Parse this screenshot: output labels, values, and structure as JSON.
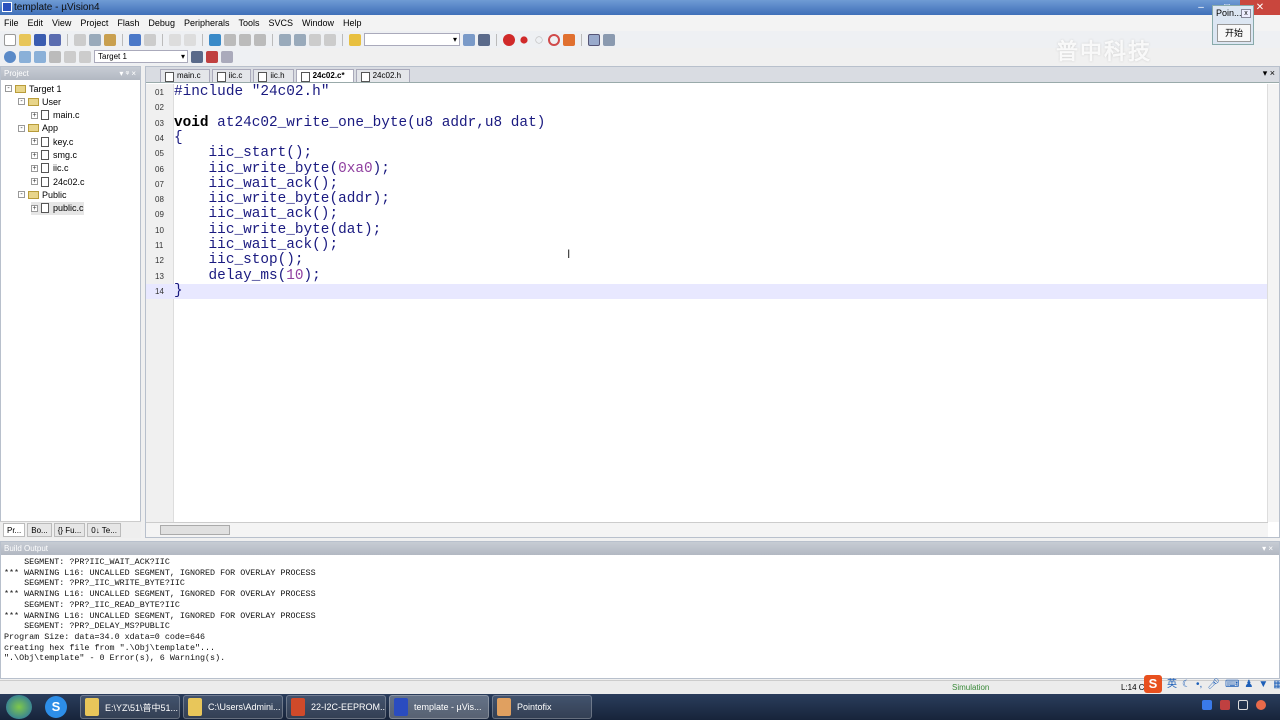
{
  "window": {
    "title": "template - µVision4"
  },
  "menu": [
    "File",
    "Edit",
    "View",
    "Project",
    "Flash",
    "Debug",
    "Peripherals",
    "Tools",
    "SVCS",
    "Window",
    "Help"
  ],
  "toolbar": {
    "target_select": "Target 1"
  },
  "watermark": "普中科技",
  "pointofix_popup": {
    "title": "Poin...",
    "close": "x",
    "start_button": "开始"
  },
  "project_panel": {
    "title": "Project",
    "header_buttons": "▾ ᵠ ×",
    "tree": [
      {
        "label": "Target 1",
        "level": 0,
        "type": "target",
        "toggle": "-"
      },
      {
        "label": "User",
        "level": 1,
        "type": "folder",
        "toggle": "-"
      },
      {
        "label": "main.c",
        "level": 2,
        "type": "file",
        "toggle": "+"
      },
      {
        "label": "App",
        "level": 1,
        "type": "folder",
        "toggle": "-"
      },
      {
        "label": "key.c",
        "level": 2,
        "type": "file",
        "toggle": "+"
      },
      {
        "label": "smg.c",
        "level": 2,
        "type": "file",
        "toggle": "+"
      },
      {
        "label": "iic.c",
        "level": 2,
        "type": "file",
        "toggle": "+"
      },
      {
        "label": "24c02.c",
        "level": 2,
        "type": "file",
        "toggle": "+"
      },
      {
        "label": "Public",
        "level": 1,
        "type": "folder",
        "toggle": "-"
      },
      {
        "label": "public.c",
        "level": 2,
        "type": "file",
        "toggle": "+",
        "selected": true
      }
    ],
    "tabs": [
      "Pr...",
      "Bo...",
      "{} Fu...",
      "0↓ Te..."
    ]
  },
  "editor": {
    "tabs": [
      {
        "label": "main.c"
      },
      {
        "label": "iic.c"
      },
      {
        "label": "iic.h"
      },
      {
        "label": "24c02.c*",
        "active": true
      },
      {
        "label": "24c02.h"
      }
    ],
    "tab_buttons": "▾ ×",
    "current_line": 14,
    "lines": [
      [
        [
          "#include ",
          "pp"
        ],
        [
          "\"24c02.h\"",
          "str"
        ]
      ],
      [],
      [
        [
          "void",
          "kw"
        ],
        [
          " at24c02_write_one_byte(u8 addr,u8 dat)",
          "pl"
        ]
      ],
      [
        [
          "{",
          "pl"
        ]
      ],
      [
        [
          "    iic_start();",
          "pl"
        ]
      ],
      [
        [
          "    iic_write_byte(",
          "pl"
        ],
        [
          "0xa0",
          "num"
        ],
        [
          ");",
          "pl"
        ]
      ],
      [
        [
          "    iic_wait_ack();",
          "pl"
        ]
      ],
      [
        [
          "    iic_write_byte(addr);",
          "pl"
        ]
      ],
      [
        [
          "    iic_wait_ack();",
          "pl"
        ]
      ],
      [
        [
          "    iic_write_byte(dat);",
          "pl"
        ]
      ],
      [
        [
          "    iic_wait_ack();",
          "pl"
        ]
      ],
      [
        [
          "    iic_stop();",
          "pl"
        ]
      ],
      [
        [
          "    delay_ms(",
          "pl"
        ],
        [
          "10",
          "num"
        ],
        [
          ");",
          "pl"
        ]
      ],
      [
        [
          "}",
          "pl"
        ]
      ]
    ],
    "line_numbers": [
      "01",
      "02",
      "03",
      "04",
      "05",
      "06",
      "07",
      "08",
      "09",
      "10",
      "11",
      "12",
      "13",
      "14"
    ]
  },
  "build_output": {
    "title": "Build Output",
    "header_buttons": "▾ ×",
    "lines": [
      "    SEGMENT: ?PR?IIC_WAIT_ACK?IIC",
      "*** WARNING L16: UNCALLED SEGMENT, IGNORED FOR OVERLAY PROCESS",
      "    SEGMENT: ?PR?_IIC_WRITE_BYTE?IIC",
      "*** WARNING L16: UNCALLED SEGMENT, IGNORED FOR OVERLAY PROCESS",
      "    SEGMENT: ?PR?_IIC_READ_BYTE?IIC",
      "*** WARNING L16: UNCALLED SEGMENT, IGNORED FOR OVERLAY PROCESS",
      "    SEGMENT: ?PR?_DELAY_MS?PUBLIC",
      "Program Size: data=34.0 xdata=0 code=646",
      "creating hex file from \".\\Obj\\template\"...",
      "\".\\Obj\\template\" - 0 Error(s), 6 Warning(s)."
    ]
  },
  "status": {
    "mode": "Simulation",
    "position": "L:14 C:",
    "ime_lang": "英"
  },
  "taskbar": {
    "items": [
      {
        "label": "E:\\YZ\\51\\普中51...",
        "color": "#e8c65a"
      },
      {
        "label": "C:\\Users\\Admini...",
        "color": "#e8c65a"
      },
      {
        "label": "22-I2C-EEPROM...",
        "color": "#d04a2a"
      },
      {
        "label": "template - µVis...",
        "color": "#2a4cc0",
        "active": true
      },
      {
        "label": "Pointofix",
        "color": "#e0a060"
      }
    ]
  }
}
